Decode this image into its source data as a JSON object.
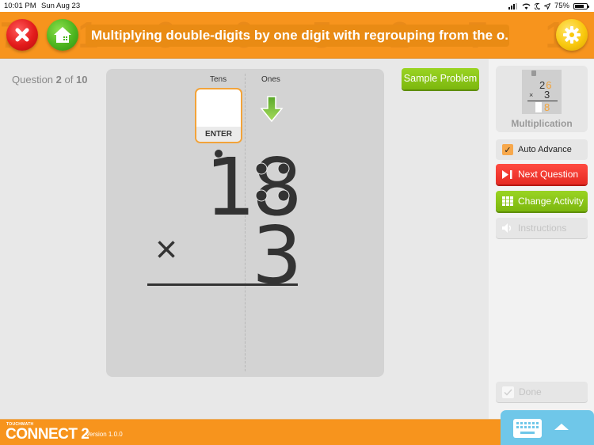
{
  "status_bar": {
    "time": "10:01 PM",
    "date": "Sun Aug 23",
    "battery": "75%",
    "battery_level": 0.75
  },
  "header": {
    "title": "Multiplying double-digits by one digit with regrouping from the o...",
    "close_icon": "close-icon",
    "home_icon": "home-icon",
    "settings_icon": "gear-icon"
  },
  "question": {
    "prefix": "Question",
    "current": "2",
    "of": "of",
    "total": "10"
  },
  "work": {
    "tens_label": "Tens",
    "ones_label": "Ones",
    "enter_label": "ENTER",
    "top_tens_digit": "1",
    "top_ones_digit": "8",
    "operator": "×",
    "bottom_ones_digit": "3"
  },
  "sample_problem_label": "Sample Problem",
  "sidebar": {
    "thumb": {
      "top": "26",
      "op": "×",
      "bottom": "3",
      "answer_ones": "8",
      "caption": "Multiplication"
    },
    "auto_advance_label": "Auto Advance",
    "auto_advance_checked": true,
    "next_question_label": "Next Question",
    "change_activity_label": "Change Activity",
    "instructions_label": "Instructions",
    "done_label": "Done"
  },
  "footer": {
    "brand_small": "TOUCHMATH",
    "brand": "CONNECT 2",
    "version": "Version 1.0.0"
  },
  "colors": {
    "orange": "#f7941d",
    "red": "#e62a22",
    "green": "#7cb70e",
    "keyboard_blue": "#6fc7e9"
  }
}
